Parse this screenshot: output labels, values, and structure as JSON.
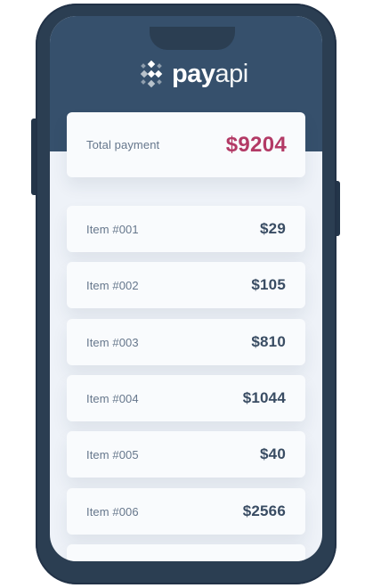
{
  "brand": {
    "name_pay": "pay",
    "name_api": "api",
    "logo_icon": "payapi-logo-icon",
    "header_color": "#36506c",
    "accent_color": "#b33a66"
  },
  "summary": {
    "label": "Total payment",
    "amount": "$9204"
  },
  "items": [
    {
      "label": "Item #001",
      "amount": "$29"
    },
    {
      "label": "Item #002",
      "amount": "$105"
    },
    {
      "label": "Item #003",
      "amount": "$810"
    },
    {
      "label": "Item #004",
      "amount": "$1044"
    },
    {
      "label": "Item #005",
      "amount": "$40"
    },
    {
      "label": "Item #006",
      "amount": "$2566"
    }
  ]
}
